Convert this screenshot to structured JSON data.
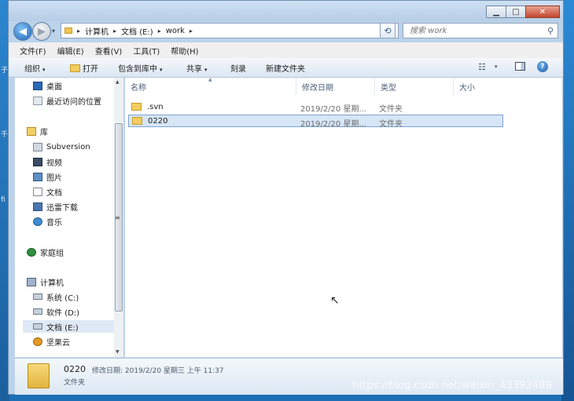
{
  "window": {
    "min": "▁",
    "max": "□",
    "close": "✕"
  },
  "nav": {
    "back_icon": "◀",
    "forward_icon": "▶",
    "history_icon": "▾",
    "refresh_icon": "⟲"
  },
  "address": {
    "crumbs": [
      "计算机",
      "文档 (E:)",
      "work"
    ],
    "sep": "▸",
    "drop": "▾"
  },
  "search": {
    "placeholder": "搜索 work",
    "icon": "⚲"
  },
  "menu": {
    "items": [
      "文件(F)",
      "编辑(E)",
      "查看(V)",
      "工具(T)",
      "帮助(H)"
    ]
  },
  "toolbar": {
    "organize": "组织",
    "open": "打开",
    "include_lib": "包含到库中",
    "share": "共享",
    "burn": "刻录",
    "new_folder": "新建文件夹",
    "caret": "▾",
    "view_icon": "☷",
    "help": "?"
  },
  "sidebar": {
    "items": [
      {
        "label": "桌面",
        "icon": "desktop-icon"
      },
      {
        "label": "最近访问的位置",
        "icon": "recent-icon"
      },
      {
        "label": "库",
        "icon": "library-icon"
      },
      {
        "label": "Subversion",
        "icon": "subversion-icon"
      },
      {
        "label": "视频",
        "icon": "video-icon"
      },
      {
        "label": "图片",
        "icon": "picture-icon"
      },
      {
        "label": "文档",
        "icon": "document-icon"
      },
      {
        "label": "迅雷下载",
        "icon": "thunder-icon"
      },
      {
        "label": "音乐",
        "icon": "music-icon"
      },
      {
        "label": "家庭组",
        "icon": "homegroup-icon"
      },
      {
        "label": "计算机",
        "icon": "computer-icon"
      },
      {
        "label": "系统 (C:)",
        "icon": "drive-icon"
      },
      {
        "label": "软件 (D:)",
        "icon": "drive-icon"
      },
      {
        "label": "文档 (E:)",
        "icon": "drive-icon"
      },
      {
        "label": "坚果云",
        "icon": "nutstore-icon"
      }
    ],
    "scroll_up": "▲",
    "scroll_grip": "≡",
    "scroll_down": "▼"
  },
  "columns": {
    "name": "名称",
    "date": "修改日期",
    "type": "类型",
    "size": "大小",
    "sort_caret": "▲"
  },
  "files": [
    {
      "name": ".svn",
      "date": "2019/2/20 星期...",
      "type": "文件夹"
    },
    {
      "name": "0220",
      "date": "2019/2/20 星期...",
      "type": "文件夹"
    }
  ],
  "cursor": "↖",
  "details": {
    "name": "0220",
    "meta": "修改日期: 2019/2/20 星期三 上午 11:37",
    "type": "文件夹"
  },
  "watermark": "https://blog.csdn.net/weixin_43392489"
}
